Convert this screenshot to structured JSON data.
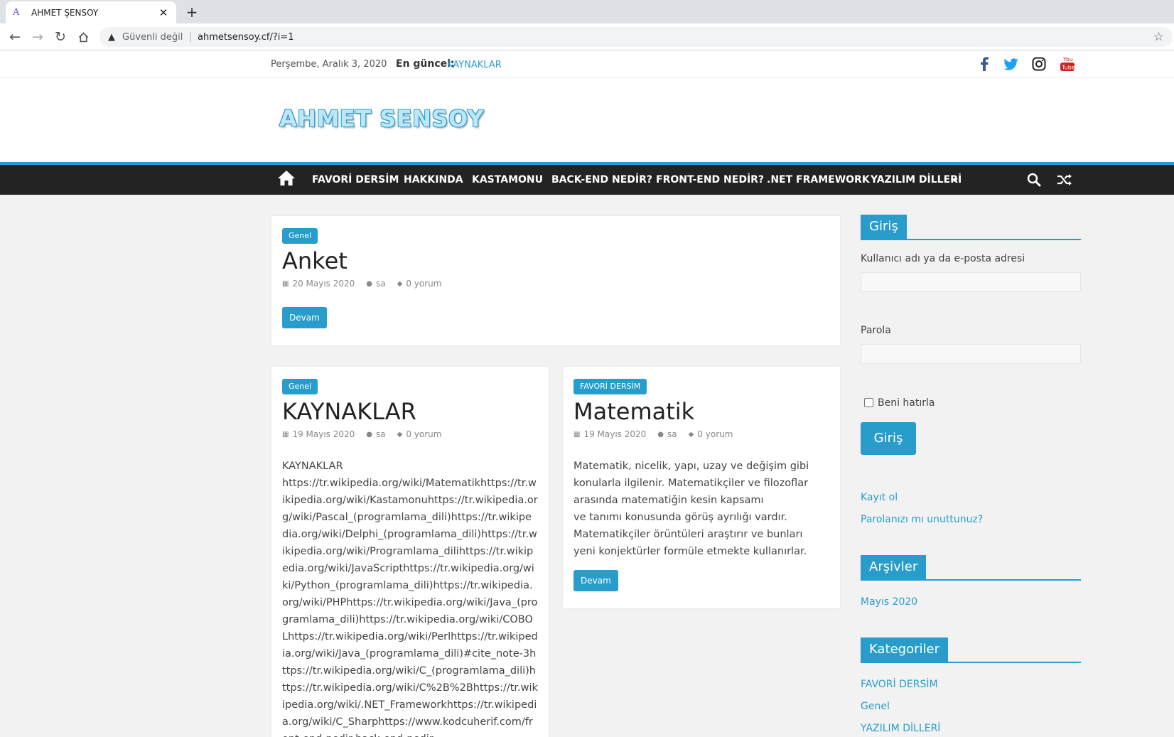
{
  "browser": {
    "tab_title": "AHMET ŞENSOY",
    "tab_favicon": "A",
    "security_label": "Güvenli değil",
    "url": "ahmetsensoy.cf/?i=1"
  },
  "topbar": {
    "date": "Perşembe, Aralık 3, 2020",
    "latest_label": "En güncel:",
    "latest_link": "KAYNAKLAR",
    "social_icons": [
      "facebook-icon",
      "twitter-icon",
      "instagram-icon",
      "youtube-icon"
    ]
  },
  "header": {
    "logo_text": "AHMET SENSOY"
  },
  "nav": {
    "items": [
      "FAVORİ DERSİM",
      "HAKKINDA",
      "KASTAMONU",
      "BACK-END NEDİR?",
      "FRONT-END NEDİR?",
      ".NET FRAMEWORK",
      "YAZILIM DİLLERİ"
    ]
  },
  "posts": [
    {
      "category": "Genel",
      "title": "Anket",
      "date": "20 Mayıs 2020",
      "author": "sa",
      "comments": "0 yorum",
      "more": "Devam"
    },
    {
      "category": "Genel",
      "title": "KAYNAKLAR",
      "date": "19 Mayıs 2020",
      "author": "sa",
      "comments": "0 yorum",
      "excerpt_first": "KAYNAKLAR",
      "excerpt_body": "https://tr.wikipedia.org/wiki/Matematikhttps://tr.wikipedia.org/wiki/Kastamonuhttps://tr.wikipedia.org/wiki/Pascal_(programlama_dili)https://tr.wikipedia.org/wiki/Delphi_(programlama_dili)https://tr.wikipedia.org/wiki/Programlama_dilihttps://tr.wikipedia.org/wiki/JavaScripthttps://tr.wikipedia.org/wiki/Python_(programlama_dili)https://tr.wikipedia.org/wiki/PHPhttps://tr.wikipedia.org/wiki/Java_(programlama_dili)https://tr.wikipedia.org/wiki/COBOLhttps://tr.wikipedia.org/wiki/Perlhttps://tr.wikipedia.org/wiki/Java_(programlama_dili)#cite_note-3https://tr.wikipedia.org/wiki/C_(programlama_dili)https://tr.wikipedia.org/wiki/C%2B%2Bhttps://tr.wikipedia.org/wiki/.NET_Frameworkhttps://tr.wikipedia.org/wiki/C_Sharphttps://www.kodcuherif.com/front-end-nedir-back-end-nedir"
    },
    {
      "category": "FAVORİ DERSİM",
      "title": "Matematik",
      "date": "19 Mayıs 2020",
      "author": "sa",
      "comments": "0 yorum",
      "excerpt_lines": [
        "Matematik, nicelik, yapı, uzay ve değişim gibi",
        "konularla ilgilenir. Matematikçiler ve filozoflar",
        "arasında matematiğin kesin kapsamı",
        "ve tanımı konusunda görüş ayrılığı vardır.",
        "Matematikçiler örüntüleri araştırır ve bunları",
        "yeni konjektürler formüle etmekte kullanırlar."
      ],
      "more": "Devam"
    }
  ],
  "sidebar": {
    "login": {
      "title": "Giriş",
      "username_label": "Kullanıcı adı ya da e-posta adresi",
      "password_label": "Parola",
      "remember_label": "Beni hatırla",
      "button": "Giriş",
      "register_link": "Kayıt ol",
      "forgot_link": "Parolanızı mı unuttunuz?"
    },
    "archives": {
      "title": "Arşivler",
      "items": [
        "Mayıs 2020"
      ]
    },
    "categories": {
      "title": "Kategoriler",
      "items": [
        "FAVORİ DERSİM",
        "Genel",
        "YAZILIM DİLLERİ"
      ]
    }
  },
  "colors": {
    "accent": "#289dcc",
    "nav_bg": "#232323"
  }
}
